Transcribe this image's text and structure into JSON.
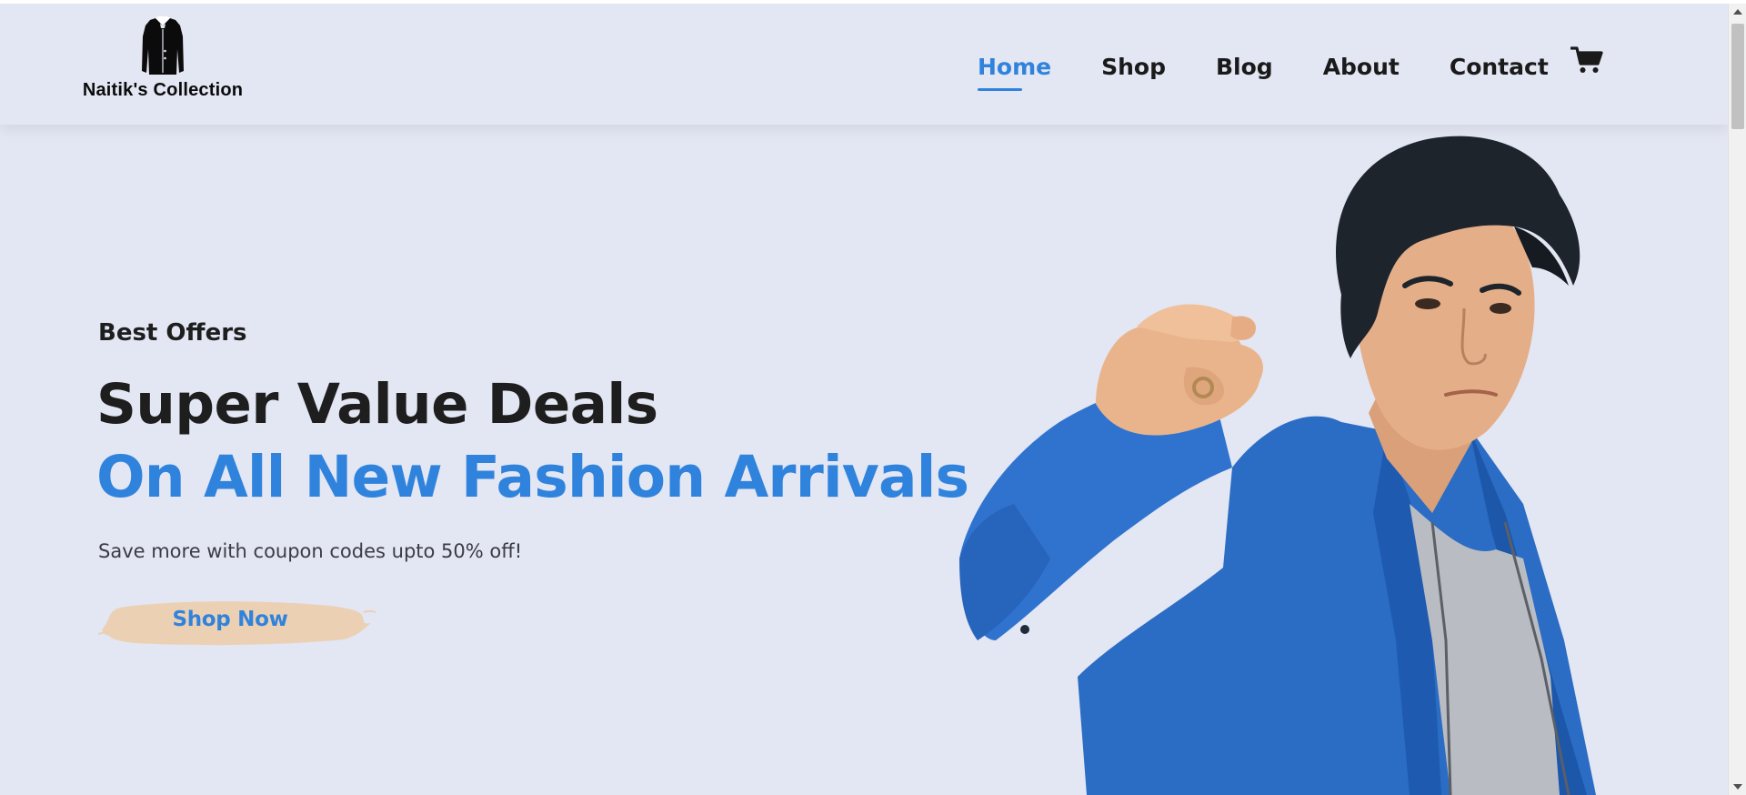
{
  "brand": {
    "name": "Naitik's Collection",
    "logo_icon": "suit-jacket-icon"
  },
  "nav": {
    "items": [
      {
        "label": "Home",
        "active": true
      },
      {
        "label": "Shop",
        "active": false
      },
      {
        "label": "Blog",
        "active": false
      },
      {
        "label": "About",
        "active": false
      },
      {
        "label": "Contact",
        "active": false
      }
    ],
    "cart_icon": "shopping-cart-icon"
  },
  "hero": {
    "eyebrow": "Best Offers",
    "title": "Super Value Deals",
    "title_accent": "On All New Fashion Arrivals",
    "subtitle": "Save more with coupon codes upto 50% off!",
    "cta_label": "Shop Now",
    "image": "model-pointing-photo"
  },
  "colors": {
    "background": "#e3e6f3",
    "accent": "#2f83dc",
    "text_dark": "#1e1e1e",
    "button_brush": "#ecd0b4"
  }
}
